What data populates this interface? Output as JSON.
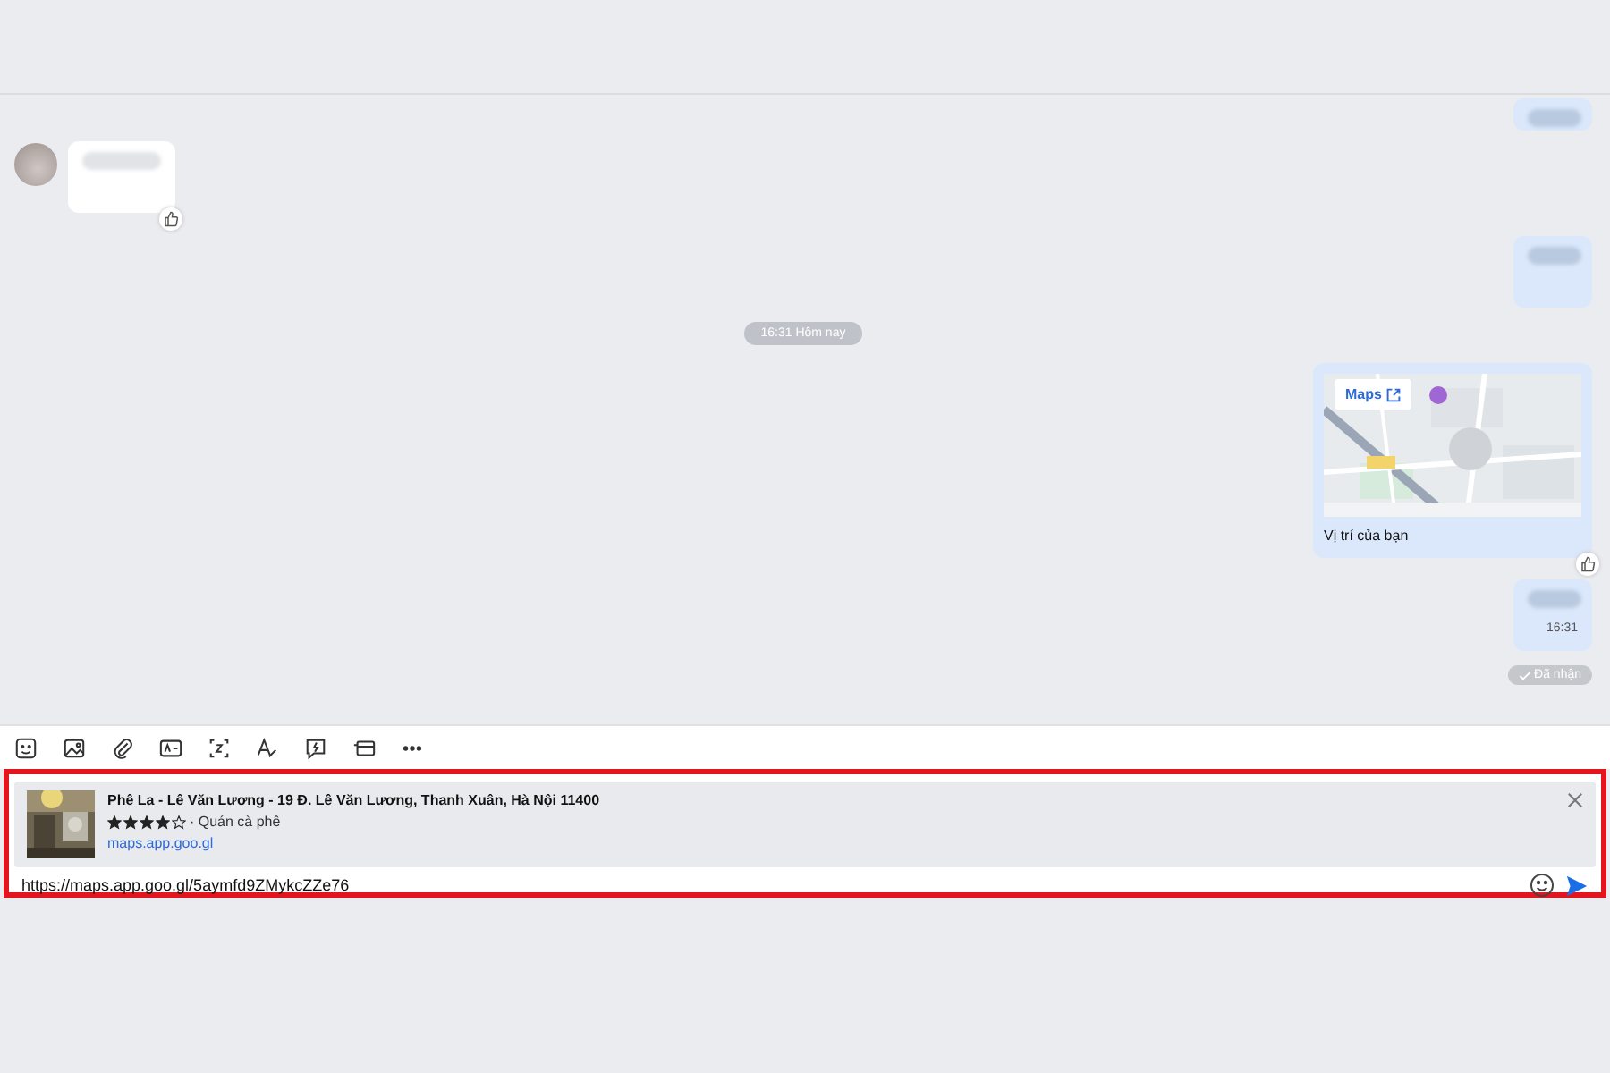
{
  "messages": [
    {
      "kind": "blurred_out",
      "reacted": false
    },
    {
      "kind": "blurred_in",
      "reacted": true
    },
    {
      "kind": "blurred_out",
      "reacted": false
    },
    {
      "kind": "divider",
      "text": "16:31 Hôm nay"
    },
    {
      "kind": "location",
      "button": "Maps",
      "caption": "Vị trí của bạn",
      "reacted": true
    },
    {
      "kind": "blurred_out",
      "time": "16:31",
      "reacted": false
    }
  ],
  "delivery_status": "Đã nhận",
  "link_preview": {
    "title": "Phê La - Lê Văn Lương - 19 Đ. Lê Văn Lương, Thanh Xuân, Hà Nội 11400",
    "stars": 4,
    "category": "· Quán cà phê",
    "domain": "maps.app.goo.gl"
  },
  "input": {
    "value": "https://maps.app.goo.gl/5aymfd9ZMykcZZe76"
  }
}
